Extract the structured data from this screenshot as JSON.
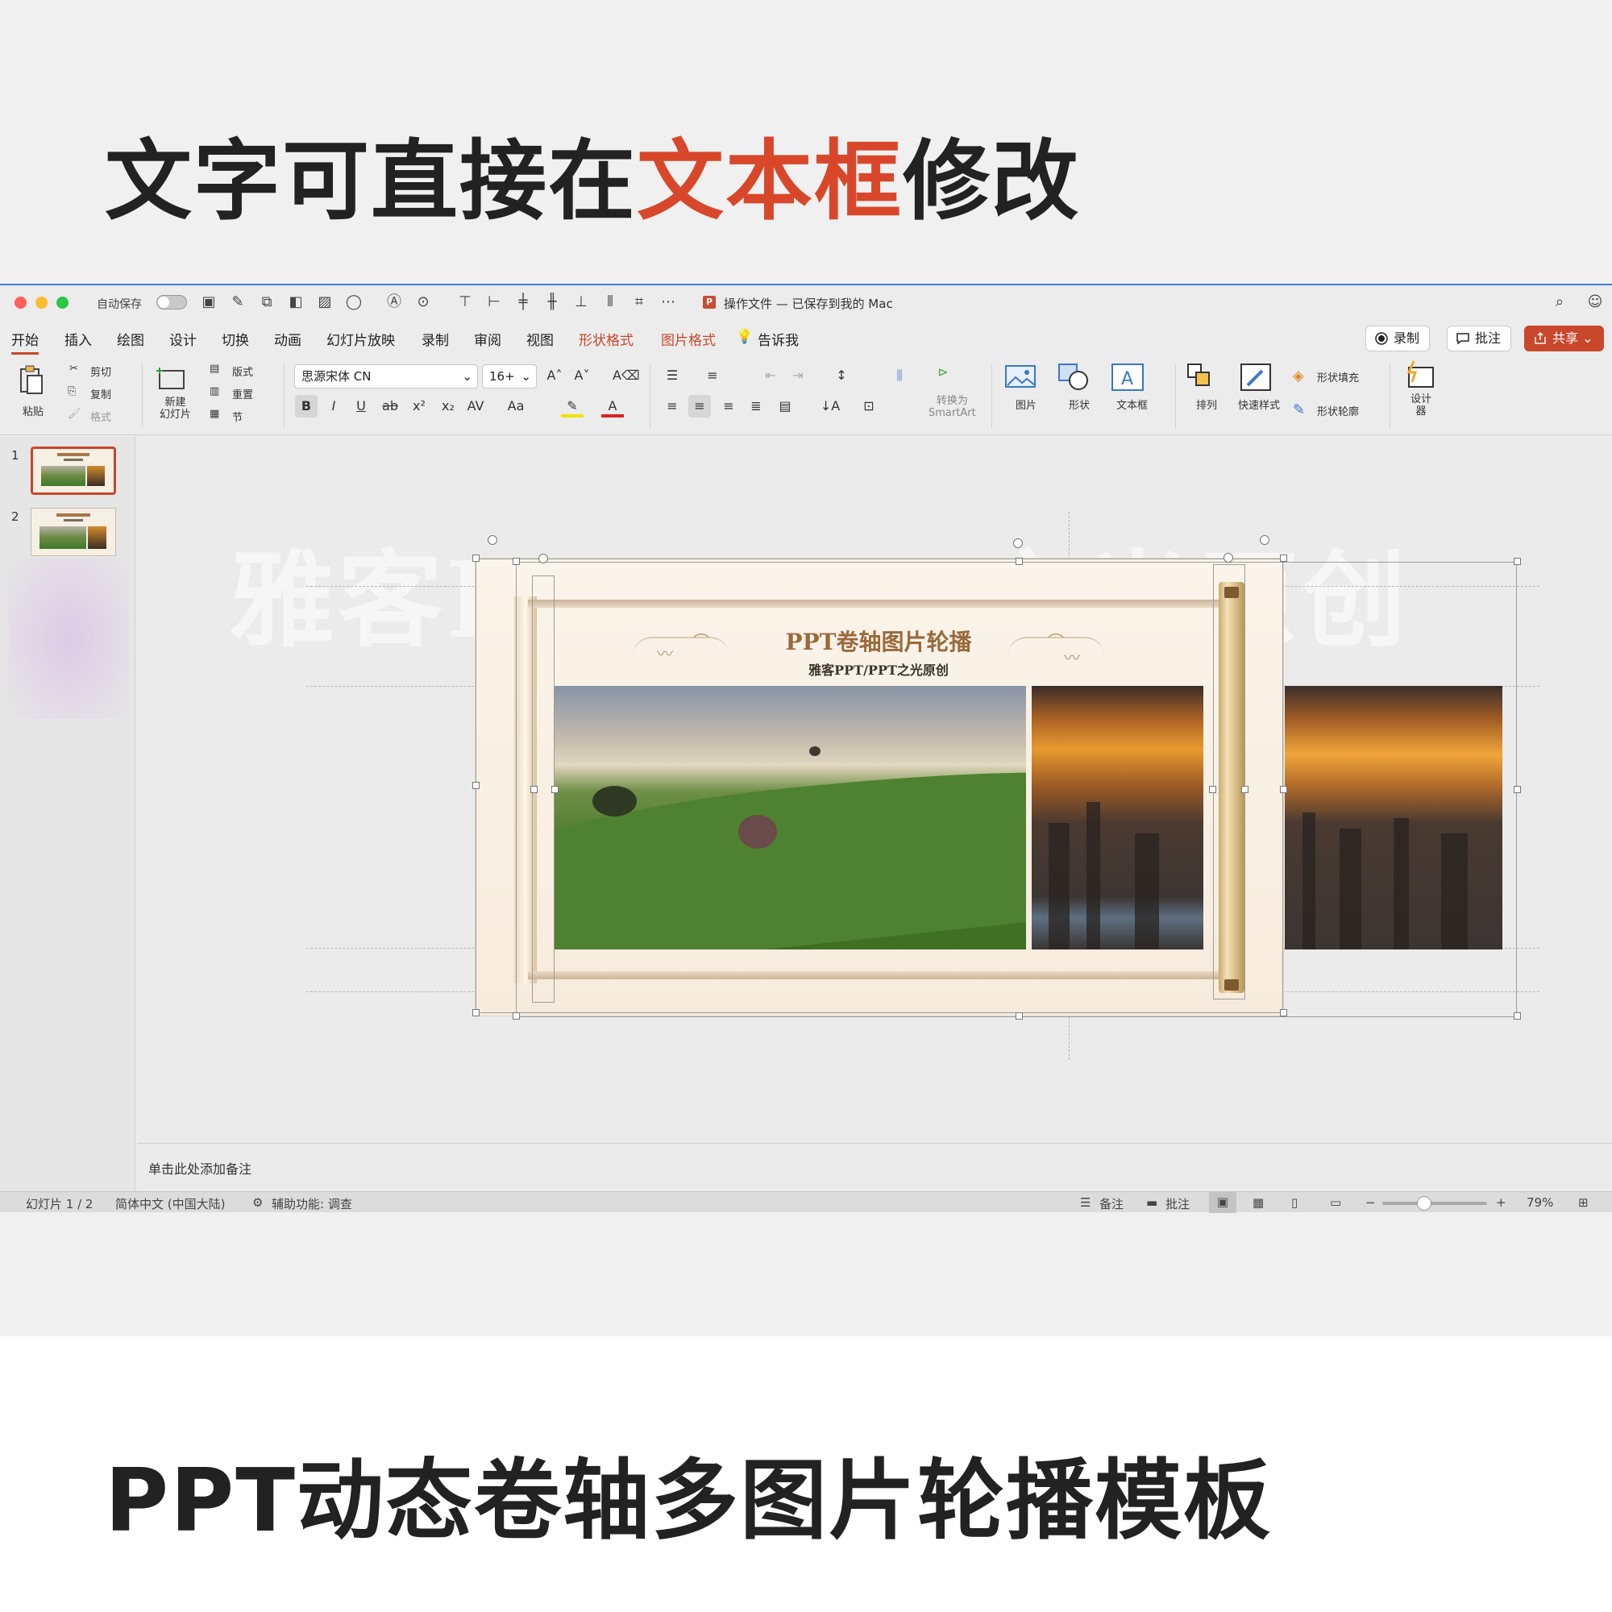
{
  "headline_top": {
    "part1": "文字可直接在",
    "accent": "文本框",
    "part2": "修改"
  },
  "headline_bottom": "PPT动态卷轴多图片轮播模板",
  "titlebar": {
    "autosave_label": "自动保存",
    "document_title": "操作文件 — 已保存到我的 Mac",
    "doc_badge": "P"
  },
  "tabs": [
    "开始",
    "插入",
    "绘图",
    "设计",
    "切换",
    "动画",
    "幻灯片放映",
    "录制",
    "审阅",
    "视图",
    "形状格式",
    "图片格式",
    "告诉我"
  ],
  "top_buttons": {
    "record": "录制",
    "comment": "批注",
    "share": "共享"
  },
  "ribbon": {
    "paste": "粘贴",
    "cut": "剪切",
    "copy": "复制",
    "format": "格式",
    "new_slide": "新建\n幻灯片",
    "layout": "版式",
    "reset": "重置",
    "section": "节",
    "font_name": "思源宋体 CN",
    "font_size": "16+",
    "bold": "B",
    "italic": "I",
    "underline": "U",
    "strike": "ab",
    "superscript": "x²",
    "subscript": "x₂",
    "char_spacing": "AV",
    "change_case": "Aa",
    "convert_smartart": "转换为\nSmartArt",
    "picture": "图片",
    "shape": "形状",
    "textbox": "文本框",
    "arrange": "排列",
    "quick_styles": "快速样式",
    "shape_fill": "形状填充",
    "shape_outline": "形状轮廓",
    "designer": "设计\n器"
  },
  "slides": [
    {
      "number": "1"
    },
    {
      "number": "2"
    }
  ],
  "slide": {
    "title": "PPT卷轴图片轮播",
    "subtitle": "雅客PPT/PPT之光原创",
    "watermark": "雅客PPT/PPT之光原创"
  },
  "notes_placeholder": "单击此处添加备注",
  "status": {
    "slide_count": "幻灯片 1 / 2",
    "language": "简体中文 (中国大陆)",
    "accessibility": "辅助功能: 调查",
    "notes": "备注",
    "comments": "批注",
    "zoom": "79%"
  },
  "colors": {
    "accent": "#c9472b",
    "headline": "#222222",
    "title_brown": "#9a6a3c"
  }
}
